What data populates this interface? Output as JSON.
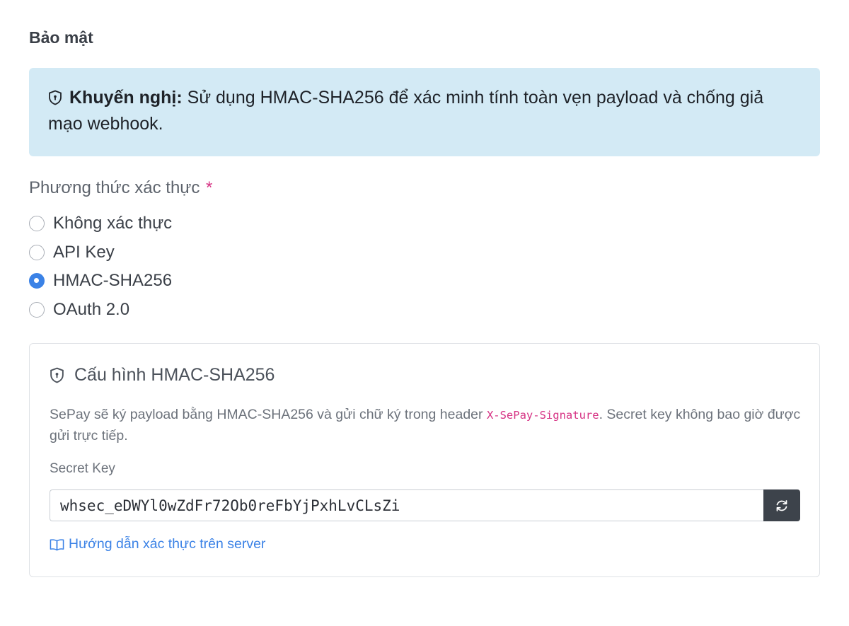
{
  "section": {
    "title": "Bảo mật"
  },
  "alert": {
    "icon": "shield-icon",
    "strong": "Khuyến nghị:",
    "text": " Sử dụng HMAC-SHA256 để xác minh tính toàn vẹn payload và chống giả mạo webhook."
  },
  "auth_method": {
    "label": "Phương thức xác thực",
    "required_mark": "*",
    "options": [
      {
        "label": "Không xác thực",
        "checked": false
      },
      {
        "label": "API Key",
        "checked": false
      },
      {
        "label": "HMAC-SHA256",
        "checked": true
      },
      {
        "label": "OAuth 2.0",
        "checked": false
      }
    ]
  },
  "hmac_card": {
    "icon": "shield-icon",
    "title": "Cấu hình HMAC-SHA256",
    "desc_before": "SePay sẽ ký payload bằng HMAC-SHA256 và gửi chữ ký trong header ",
    "desc_code": "X-SePay-Signature",
    "desc_after": ". Secret key không bao giờ được gửi trực tiếp.",
    "key_label": "Secret Key",
    "key_value": "whsec_eDWYl0wZdFr72Ob0reFbYjPxhLvCLsZi",
    "regen_icon": "refresh-icon",
    "guide_icon": "book-icon",
    "guide_link": "Hướng dẫn xác thực trên server"
  },
  "colors": {
    "accent": "#3b82e6",
    "alert_bg": "#d3eaf5",
    "required": "#d63384",
    "button_dark": "#3d434b"
  }
}
